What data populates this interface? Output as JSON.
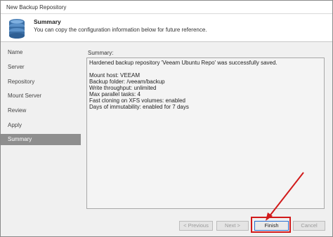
{
  "window": {
    "title": "New Backup Repository"
  },
  "header": {
    "icon": "database-icon",
    "title": "Summary",
    "subtitle": "You can copy the configuration information below for future reference."
  },
  "nav": {
    "items": [
      {
        "label": "Name",
        "active": false
      },
      {
        "label": "Server",
        "active": false
      },
      {
        "label": "Repository",
        "active": false
      },
      {
        "label": "Mount Server",
        "active": false
      },
      {
        "label": "Review",
        "active": false
      },
      {
        "label": "Apply",
        "active": false
      },
      {
        "label": "Summary",
        "active": true
      }
    ]
  },
  "content": {
    "summary_label": "Summary:",
    "lines": [
      "Hardened backup repository 'Veeam Ubuntu Repo' was successfully saved.",
      "",
      "Mount host: VEEAM",
      "Backup folder: /veeam/backup",
      "Write throughput: unlimited",
      "Max parallel tasks: 4",
      "Fast cloning on XFS volumes: enabled",
      "Days of immutability: enabled for 7 days"
    ]
  },
  "footer": {
    "previous_label": "< Previous",
    "next_label": "Next >",
    "finish_label": "Finish",
    "cancel_label": "Cancel"
  },
  "annotation": {
    "highlight_color": "#d11a1a"
  }
}
